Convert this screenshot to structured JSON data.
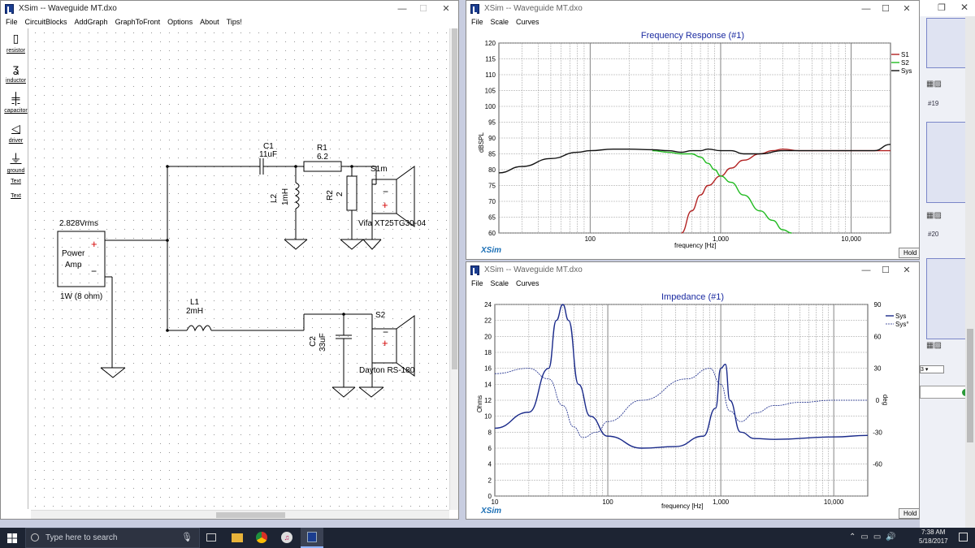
{
  "left_window": {
    "title": "XSim -- Waveguide MT.dxo",
    "menu": [
      "File",
      "CircuitBlocks",
      "AddGraph",
      "GraphToFront",
      "Options",
      "About",
      "Tips!"
    ],
    "palette": [
      "resistor",
      "inductor",
      "capacitor",
      "driver",
      "ground",
      "Text",
      "Text"
    ]
  },
  "schematic": {
    "source_voltage": "2.828Vrms",
    "amp_line1": "Power",
    "amp_line2": "Amp",
    "amp_rating": "1W (8 ohm)",
    "c1_name": "C1",
    "c1_value": "11uF",
    "r1_name": "R1",
    "r1_value": "6.2",
    "l2_name": "L2",
    "l2_value": "1mH",
    "r2_name": "R2",
    "r2_value": "2",
    "s1_name": "S1m",
    "s1_label": "Vifa  XT25TG30-04",
    "l1_name": "L1",
    "l1_value": "2mH",
    "c2_name": "C2",
    "c2_value": "33uF",
    "s2_name": "S2",
    "s2_label": "Dayton RS-180"
  },
  "freq_window": {
    "title": "XSim -- Waveguide MT.dxo",
    "menu": [
      "File",
      "Scale",
      "Curves"
    ]
  },
  "imp_window": {
    "title": "XSim -- Waveguide MT.dxo",
    "menu": [
      "File",
      "Scale",
      "Curves"
    ]
  },
  "brand": "XSim",
  "hold_label": "Hold",
  "chart_data": [
    {
      "type": "line",
      "title": "Frequency Response (#1)",
      "xlabel": "frequency [Hz]",
      "ylabel": "dBSPL",
      "x_scale": "log",
      "xlim": [
        20,
        20000
      ],
      "ylim": [
        60,
        120
      ],
      "yticks": [
        "60",
        "65",
        "70",
        "75",
        "80",
        "85",
        "90",
        "95",
        "100",
        "105",
        "110",
        "115",
        "120"
      ],
      "xticks": [
        "100",
        "1,000",
        "10,000"
      ],
      "series": [
        {
          "name": "S1",
          "color": "#b22222",
          "x": [
            500,
            600,
            700,
            800,
            1000,
            1200,
            1500,
            2000,
            2500,
            3000,
            4000,
            6000,
            10000,
            20000
          ],
          "y": [
            60,
            67,
            72,
            75,
            78,
            80.5,
            83,
            85,
            86,
            86.5,
            86,
            86,
            86,
            86
          ]
        },
        {
          "name": "S2",
          "color": "#22bb22",
          "x": [
            300,
            400,
            500,
            600,
            700,
            800,
            900,
            1000,
            1200,
            1500,
            2000,
            2500,
            3000,
            3500
          ],
          "y": [
            86,
            85.5,
            85,
            85,
            84,
            82,
            80,
            78,
            76,
            72,
            67,
            64,
            61,
            59.5
          ]
        },
        {
          "name": "Sys",
          "color": "#111111",
          "x": [
            20,
            30,
            50,
            80,
            100,
            150,
            200,
            300,
            400,
            500,
            600,
            700,
            800,
            1000,
            1200,
            1500,
            2000,
            3000,
            5000,
            10000,
            15000,
            20000
          ],
          "y": [
            79,
            81,
            83.5,
            85.5,
            86,
            86.5,
            86.5,
            86.3,
            86,
            85.5,
            86,
            86,
            86.5,
            86,
            86,
            85,
            85,
            86,
            86,
            86,
            86,
            88
          ]
        }
      ]
    },
    {
      "type": "line",
      "title": "Impedance (#1)",
      "xlabel": "frequency [Hz]",
      "ylabel": "Ohms",
      "ylabel_right": "deg",
      "x_scale": "log",
      "xlim": [
        10,
        20000
      ],
      "ylim": [
        0,
        24
      ],
      "ylim_right": [
        -90,
        90
      ],
      "yticks": [
        "0",
        "2",
        "4",
        "6",
        "8",
        "10",
        "12",
        "14",
        "16",
        "18",
        "20",
        "22",
        "24"
      ],
      "yticks_right": [
        "-60",
        "-30",
        "0",
        "30",
        "60",
        "90"
      ],
      "xticks": [
        "10",
        "100",
        "1,000",
        "10,000"
      ],
      "series": [
        {
          "name": "Sys",
          "color": "#1a2a8a",
          "axis": "left",
          "x": [
            10,
            20,
            30,
            35,
            40,
            45,
            55,
            70,
            100,
            200,
            400,
            700,
            900,
            1000,
            1100,
            1200,
            1500,
            2000,
            3000,
            10000,
            20000
          ],
          "y": [
            8.5,
            10.5,
            16,
            22,
            27,
            22,
            14,
            10,
            7.5,
            6,
            6.2,
            7.5,
            11,
            16,
            16.5,
            12,
            8,
            7.2,
            7.1,
            7.4,
            7.6
          ]
        },
        {
          "name": "Sys°",
          "color": "#1a2a8a",
          "axis": "right",
          "dashed": true,
          "x": [
            10,
            20,
            30,
            40,
            50,
            60,
            80,
            100,
            200,
            500,
            800,
            1000,
            1200,
            1500,
            2000,
            3000,
            5000,
            10000,
            20000
          ],
          "y": [
            25,
            30,
            20,
            -5,
            -25,
            -35,
            -30,
            -20,
            0,
            20,
            30,
            15,
            -10,
            -20,
            -12,
            -5,
            -2,
            0,
            0
          ]
        }
      ]
    }
  ],
  "taskbar": {
    "search_placeholder": "Type here to search",
    "time": "7:38 AM",
    "date": "5/18/2017"
  },
  "right_panel": {
    "items": [
      "#19",
      "#20"
    ]
  }
}
